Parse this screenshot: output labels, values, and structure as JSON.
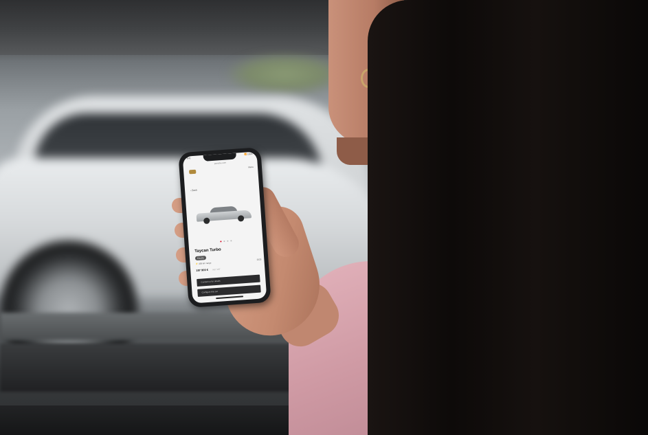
{
  "scene": {
    "description_colors": {
      "sweater": "#d6a3ad",
      "car": "#dfe2e4",
      "hair": "#120d0b",
      "accent_red": "#d5001c"
    }
  },
  "phone_screen": {
    "status_time": "9:41",
    "status_icons": "📶 100%",
    "url": "porsche.com",
    "menu_label": "Menu",
    "back_label": "‹  Back",
    "model_name": "Taycan Turbo",
    "badge": "Electric",
    "spec_left": "⚡ 400 km range",
    "spec_right": "2023",
    "price": "197 900 €",
    "price_note": "incl. VAT",
    "button_primary": "Contact us for details",
    "button_secondary": "Configure this car",
    "carousel_dots": 4,
    "carousel_active": 0
  }
}
